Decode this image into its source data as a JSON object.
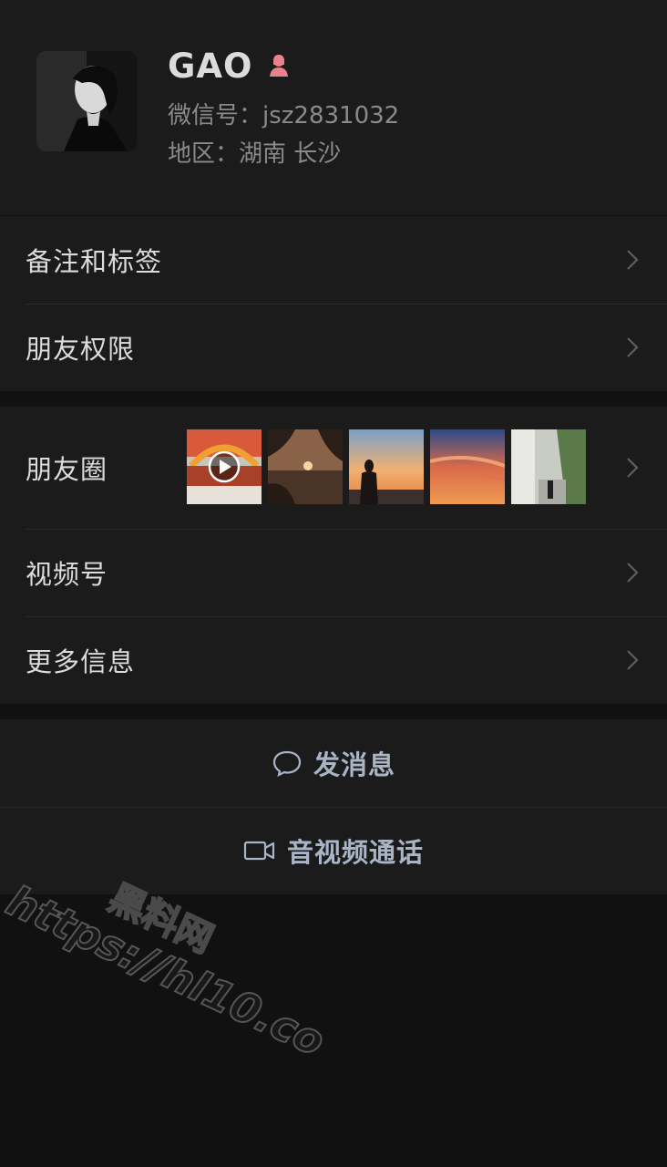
{
  "profile": {
    "name": "GAO",
    "wechat_id": "微信号：jsz2831032",
    "region": "地区：湖南 长沙"
  },
  "menu": {
    "remark": "备注和标签",
    "privacy": "朋友权限",
    "moments": "朋友圈",
    "channels": "视频号",
    "more_info": "更多信息"
  },
  "actions": {
    "message": "发消息",
    "call": "音视频通话"
  },
  "watermark": {
    "cn": "黑料网",
    "url": "https://hl10.co"
  },
  "colors": {
    "background": "#111111",
    "card": "#1b1b1b",
    "action_text": "#a9b4c6",
    "gender_icon": "#e8828c"
  }
}
